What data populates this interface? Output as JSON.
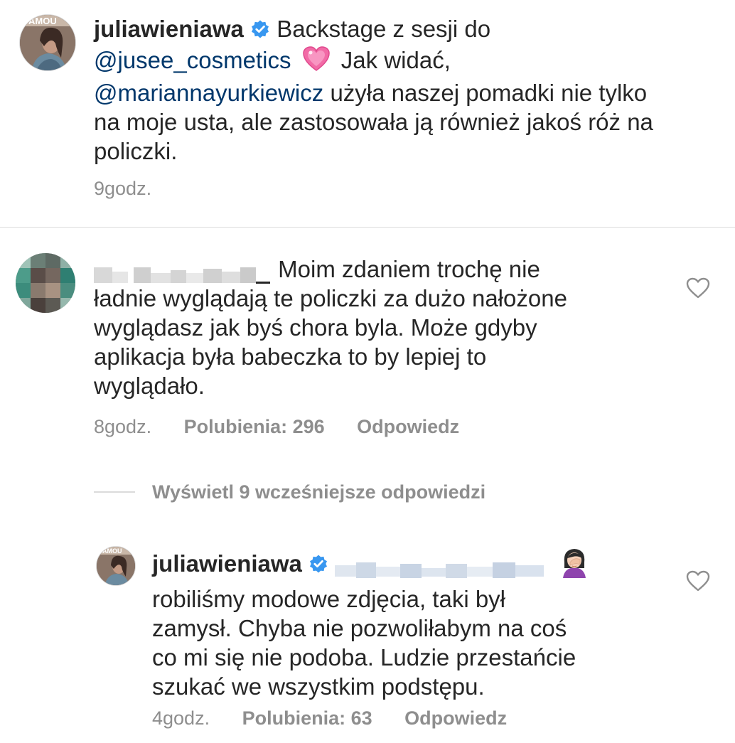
{
  "caption": {
    "username": "juliawieniawa",
    "text_1": "Backstage z sesji do",
    "mention_1": "@jusee_cosmetics",
    "text_2": "Jak widać,",
    "mention_2": "@mariannayurkiewicz",
    "text_3": "użyła naszej pomadki nie tylko",
    "line_4": "na moje usta, ale zastosowała ją również jakoś róż na",
    "line_5": "policzki.",
    "time": "9godz."
  },
  "comment_1": {
    "line_1": "Moim zdaniem trochę nie",
    "line_2": "ładnie wyglądają te policzki za dużo nałożone",
    "line_3": "wyglądasz jak byś chora byla. Może gdyby",
    "line_4": "aplikacja była babeczka to by lepiej to",
    "line_5": "wyglądało.",
    "time": "8godz.",
    "likes": "Polubienia: 296",
    "reply": "Odpowiedz"
  },
  "view_replies": "Wyświetl 9 wcześniejsze odpowiedzi",
  "reply_1": {
    "username": "juliawieniawa",
    "line_1": "robiliśmy modowe zdjęcia, taki był",
    "line_2": "zamysł. Chyba nie pozwoliłabym na coś",
    "line_3": "co mi się nie podoba. Ludzie przestańcie",
    "line_4": "szukać we wszystkim podstępu.",
    "time": "4godz.",
    "likes": "Polubienia: 63",
    "reply": "Odpowiedz"
  },
  "colors": {
    "text": "#262626",
    "mention": "#00376b",
    "meta": "#8e8e8e",
    "verified": "#3897f0",
    "divider": "#dbdbdb"
  },
  "icons": [
    "verified-badge-icon",
    "heart-outline-icon",
    "sparkling-heart-emoji",
    "facepalm-emoji"
  ]
}
